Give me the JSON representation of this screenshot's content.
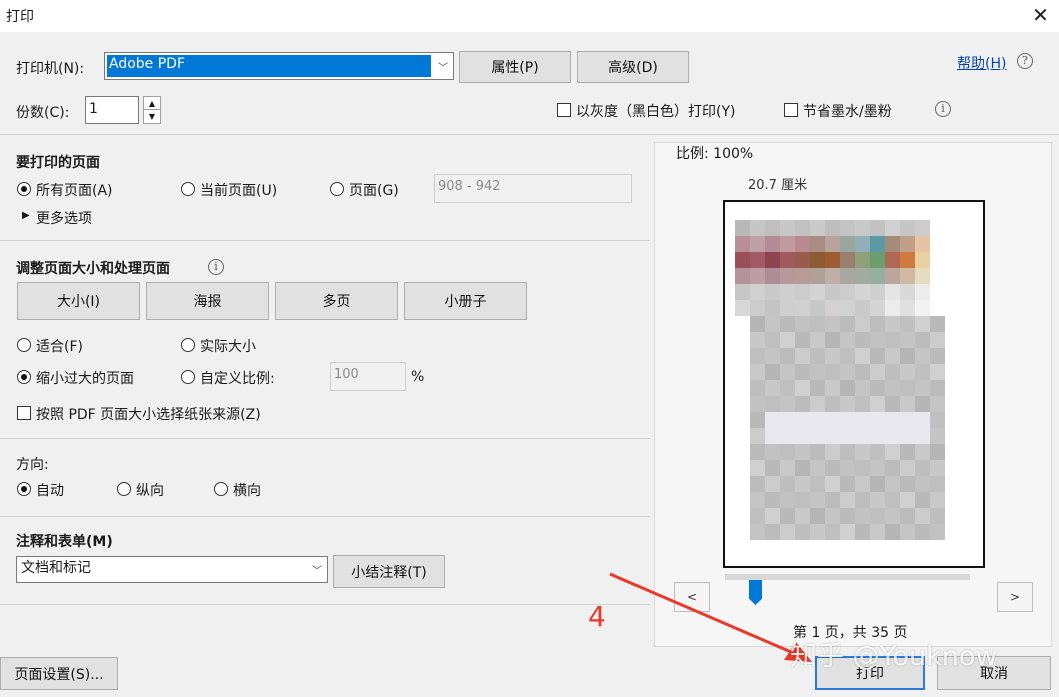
{
  "window": {
    "title": "打印",
    "close_glyph": "✕"
  },
  "printer": {
    "label": "打印机(N):",
    "selected": "Adobe PDF",
    "properties_button": "属性(P)",
    "advanced_button": "高级(D)",
    "help_link": "帮助(H)"
  },
  "copies": {
    "label": "份数(C):",
    "value": "1"
  },
  "options": {
    "grayscale_label": "以灰度（黑白色）打印(Y)",
    "save_ink_label": "节省墨水/墨粉"
  },
  "pages_to_print": {
    "heading": "要打印的页面",
    "all_pages": "所有页面(A)",
    "current_page": "当前页面(U)",
    "pages": "页面(G)",
    "pages_range": "908 - 942",
    "more_options": "更多选项"
  },
  "page_sizing": {
    "heading": "调整页面大小和处理页面",
    "tabs": [
      "大小(I)",
      "海报",
      "多页",
      "小册子"
    ],
    "fit": "适合(F)",
    "actual_size": "实际大小",
    "shrink_oversized": "缩小过大的页面",
    "custom_scale": "自定义比例:",
    "custom_scale_value": "100",
    "percent": "%",
    "choose_paper_source": "按照 PDF 页面大小选择纸张来源(Z)"
  },
  "orientation": {
    "label": "方向:",
    "auto": "自动",
    "portrait": "纵向",
    "landscape": "横向"
  },
  "comments_forms": {
    "heading": "注释和表单(M)",
    "selected": "文档和标记",
    "summarize_button": "小结注释(T)"
  },
  "preview": {
    "scale_label": "比例: 100%",
    "dimension_text": "20.7 厘米",
    "page_status": "第 1 页，共 35 页",
    "prev": "<",
    "next": ">"
  },
  "footer": {
    "page_setup_button": "页面设置(S)...",
    "print_button": "打印",
    "cancel_button": "取消"
  },
  "annotation": {
    "step_number": "4",
    "watermark": "知乎 @Youknow"
  },
  "colors": {
    "accent": "#0078d7",
    "annotation_red": "#e8392b",
    "link": "#0645ad"
  }
}
